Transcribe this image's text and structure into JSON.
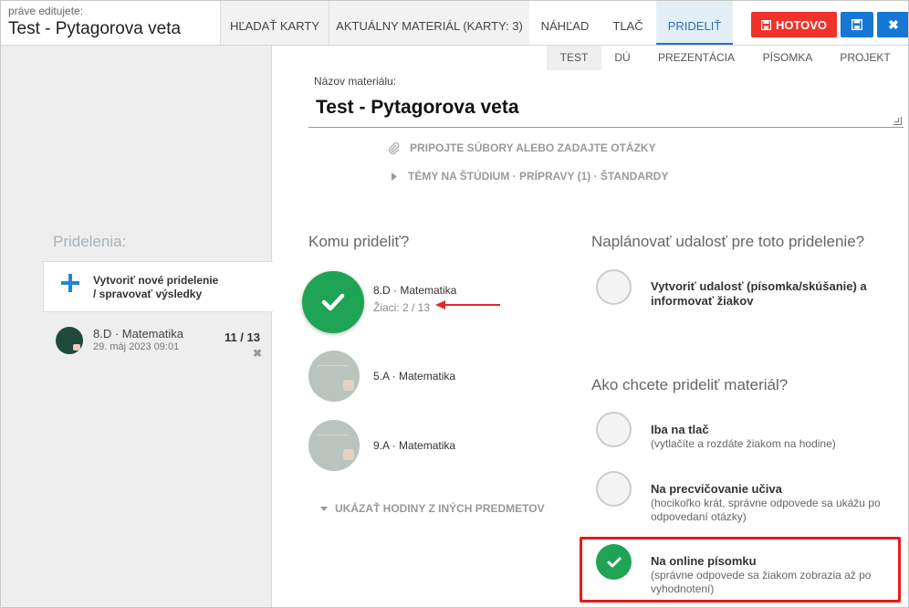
{
  "header": {
    "editing_caption": "práve editujete:",
    "editing_title": "Test - Pytagorova veta",
    "tabs": [
      {
        "label": "HĽADAŤ KARTY"
      },
      {
        "label": "AKTUÁLNY MATERIÁL (KARTY: 3)"
      },
      {
        "label": "NÁHĽAD"
      },
      {
        "label": "TLAČ"
      },
      {
        "label": "PRIDELIŤ",
        "active": true
      }
    ],
    "done_label": "HOTOVO",
    "save_icon": "floppy-disk-icon",
    "close_icon": "close-icon"
  },
  "material_types": [
    {
      "label": "TEST",
      "active": true
    },
    {
      "label": "DÚ"
    },
    {
      "label": "PREZENTÁCIA"
    },
    {
      "label": "PÍSOMKA"
    },
    {
      "label": "PROJEKT"
    }
  ],
  "material": {
    "name_label": "Názov materiálu:",
    "name_value": "Test - Pytagorova veta",
    "attach_label": "PRIPOJTE SÚBORY ALEBO ZADAJTE OTÁZKY",
    "topics_label": "TÉMY NA ŠTÚDIUM · PRÍPRAVY (1) · ŠTANDARDY"
  },
  "sidebar": {
    "heading": "Pridelenia:",
    "new_assignment_line1": "Vytvoriť nové pridelenie",
    "new_assignment_line2": "/ spravovať výsledky",
    "assignments": [
      {
        "class": "8.D · Matematika",
        "date": "29. máj 2023 09:01",
        "count": "11 / 13"
      }
    ]
  },
  "assign_to": {
    "heading": "Komu prideliť?",
    "classes": [
      {
        "name": "8.D · Matematika",
        "students": "Žiaci: 2 / 13",
        "selected": true
      },
      {
        "name": "5.A · Matematika",
        "selected": false
      },
      {
        "name": "9.A · Matematika",
        "selected": false
      }
    ],
    "more_label": "UKÁZAŤ HODINY Z INÝCH PREDMETOV"
  },
  "schedule": {
    "heading": "Naplánovať udalosť pre toto pridelenie?",
    "option_line1": "Vytvoriť udalosť (písomka/skúšanie) a",
    "option_line2": "informovať žiakov",
    "checked": false
  },
  "distribution": {
    "heading": "Ako chcete prideliť materiál?",
    "options": [
      {
        "title": "Iba na tlač",
        "desc1": "(vytlačíte a rozdáte žiakom na hodine)",
        "desc2": "",
        "checked": false
      },
      {
        "title": "Na precvičovanie učiva",
        "desc1": "(hocikoľko krát, správne odpovede sa ukážu po",
        "desc2": "odpovedaní otázky)",
        "checked": false
      },
      {
        "title": "Na online písomku",
        "desc1": "(správne odpovede sa žiakom zobrazia až po",
        "desc2": "vyhodnotení)",
        "checked": true
      }
    ]
  },
  "colors": {
    "accent_blue": "#2a72b5",
    "done_red": "#f0322a",
    "check_green": "#1fa455",
    "highlight_red": "#e8191b"
  }
}
